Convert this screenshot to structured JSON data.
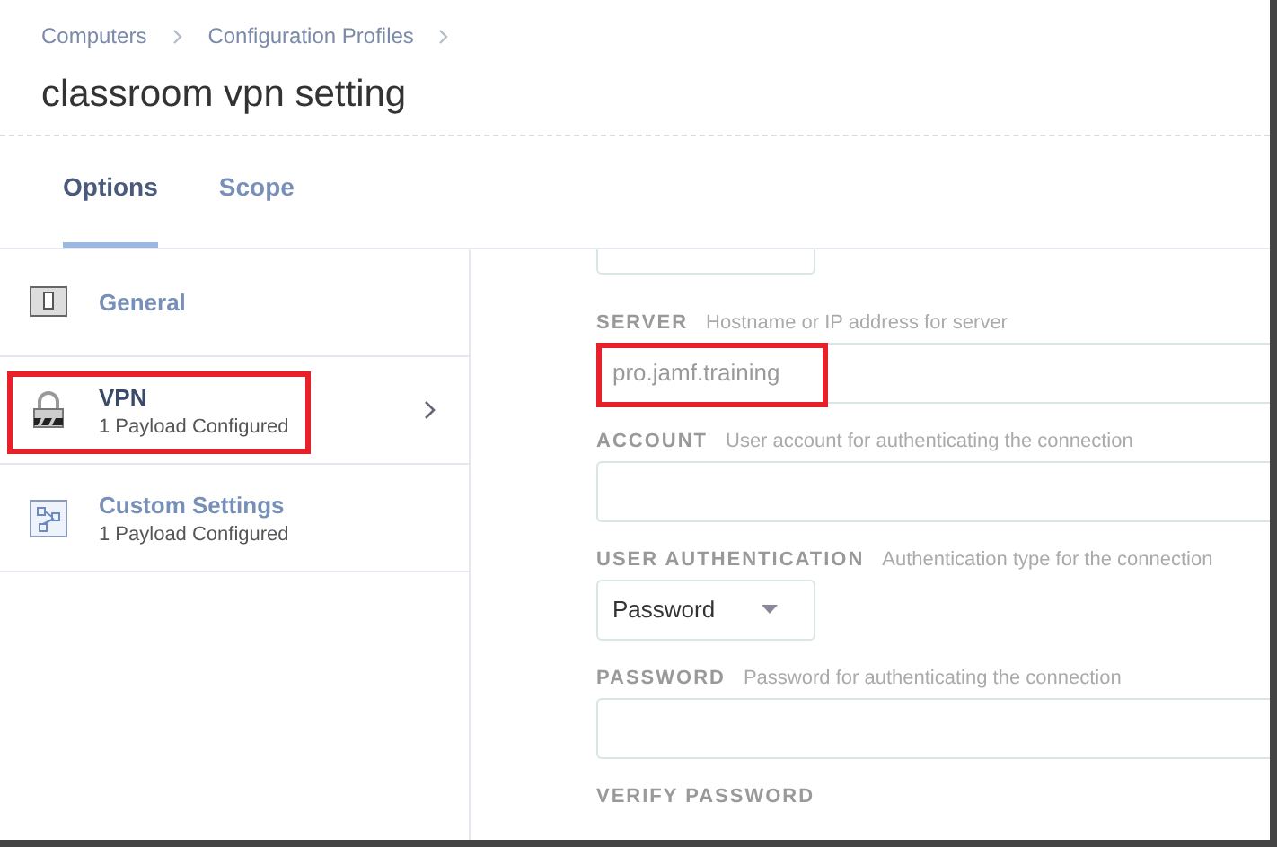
{
  "breadcrumbs": [
    "Computers",
    "Configuration Profiles"
  ],
  "title": "classroom vpn setting",
  "tabs": [
    {
      "label": "Options",
      "selected": true
    },
    {
      "label": "Scope",
      "selected": false
    }
  ],
  "sidebar": {
    "items": [
      {
        "kind": "general",
        "label": "General",
        "selected": false,
        "highlighted": false
      },
      {
        "kind": "vpn",
        "label": "VPN",
        "subtitle": "1 Payload Configured",
        "selected": true,
        "highlighted": true
      },
      {
        "kind": "custom",
        "label": "Custom Settings",
        "subtitle": "1 Payload Configured",
        "selected": false,
        "highlighted": false
      }
    ]
  },
  "form": {
    "fields": [
      {
        "kind": "select"
      },
      {
        "kind": "text",
        "label": "SERVER",
        "hint": "Hostname or IP address for server",
        "value": "pro.jamf.training",
        "highlighted": true
      },
      {
        "kind": "text",
        "label": "ACCOUNT",
        "hint": "User account for authenticating the connection",
        "highlighted": false
      },
      {
        "kind": "select",
        "label": "USER AUTHENTICATION",
        "hint": "Authentication type for the connection",
        "value": "Password"
      },
      {
        "kind": "text",
        "label": "PASSWORD",
        "hint": "Password for authenticating the connection",
        "highlighted": false
      },
      {
        "kind": "label",
        "label": "VERIFY PASSWORD"
      }
    ]
  }
}
